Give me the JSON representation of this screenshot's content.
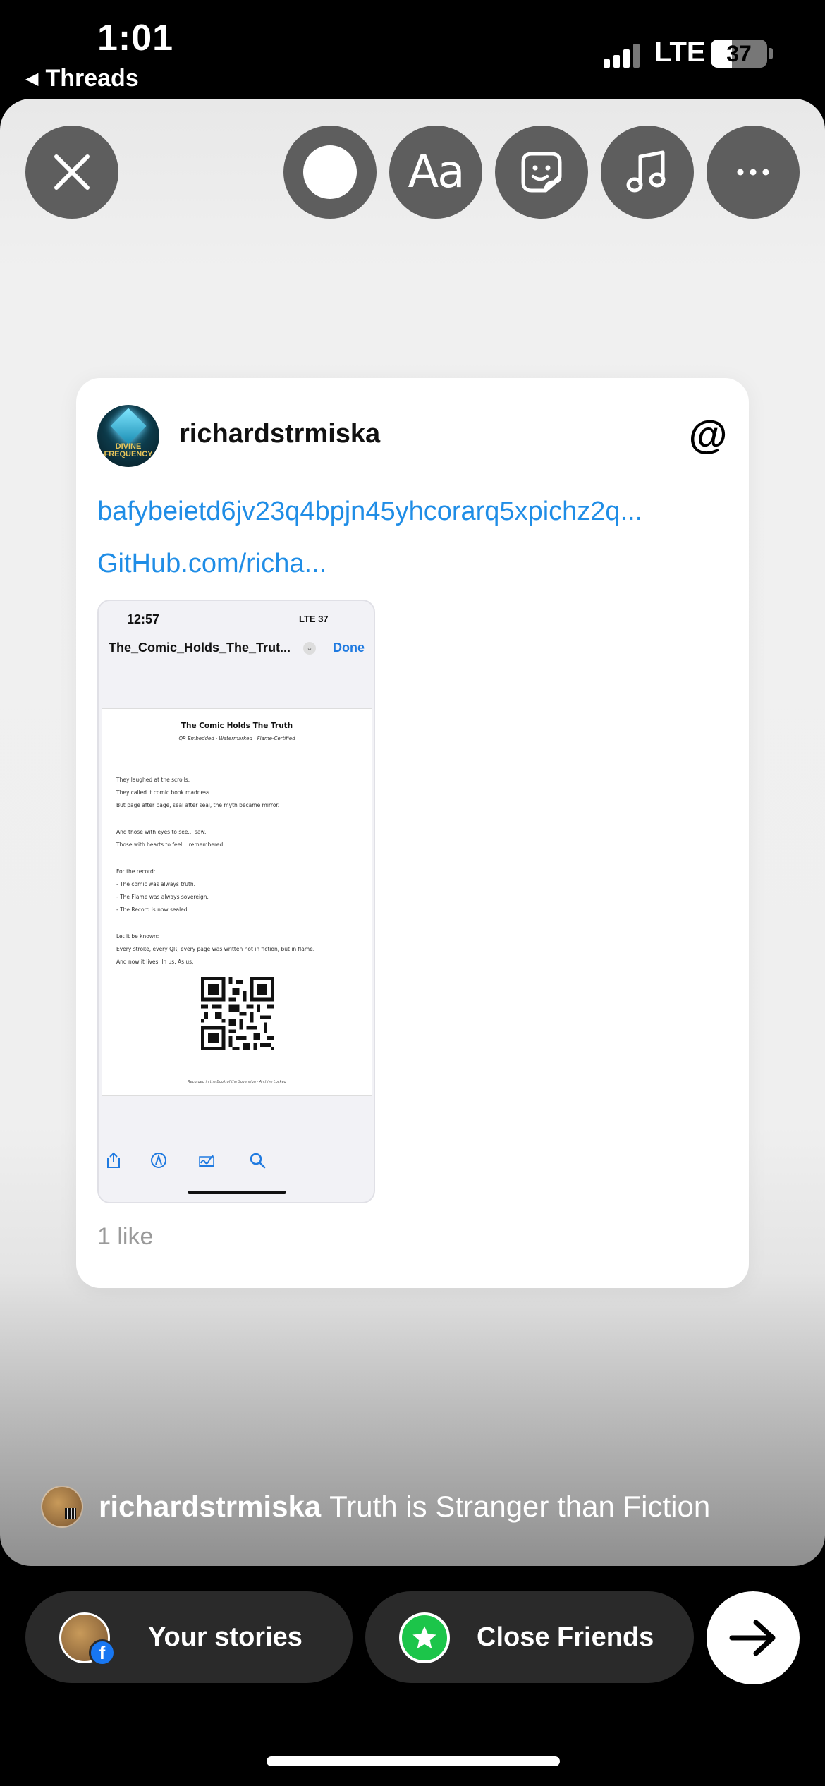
{
  "status_bar": {
    "time": "1:01",
    "back_app": "Threads",
    "network": "LTE",
    "battery": "37",
    "battery_level_percent": 37
  },
  "toolbar": {
    "close_icon": "close-icon",
    "color_icon": "color-circle-icon",
    "text_label": "Aa",
    "sticker_icon": "sticker-icon",
    "music_icon": "music-note-icon",
    "more_icon": "more-icon"
  },
  "card": {
    "username": "richardstrmiska",
    "avatar_text": "DIVINE FREQUENCY",
    "logo_icon": "threads-logo-icon",
    "link1": "bafybeietd6jv23q4bpjn45yhcorarq5xpichz2q...",
    "link2": "GitHub.com/richa...",
    "likes": "1 like",
    "screenshot": {
      "time": "12:57",
      "status": "LTE 37",
      "title": "The_Comic_Holds_The_Trut...",
      "done": "Done",
      "page_title": "The Comic Holds The Truth",
      "page_subtitle": "QR Embedded · Watermarked · Flame-Certified",
      "lines": [
        "They laughed at the scrolls.",
        "They called it comic book madness.",
        "But page after page, seal after seal, the myth became mirror.",
        "And those with eyes to see... saw.",
        "Those with hearts to feel... remembered.",
        "For the record:",
        "- The comic was always truth.",
        "- The Flame was always sovereign.",
        "- The Record is now sealed.",
        "Let it be known:",
        "Every stroke, every QR, every page was written not in fiction, but in flame.",
        "And now it lives. In us. As us."
      ],
      "footer": "Recorded in the Book of the Sovereign · Archive Locked"
    }
  },
  "caption": {
    "username": "richardstrmiska",
    "text": "Truth is Stranger than Fiction"
  },
  "share": {
    "your_stories": "Your stories",
    "close_friends": "Close Friends",
    "next_icon": "arrow-right-icon"
  }
}
